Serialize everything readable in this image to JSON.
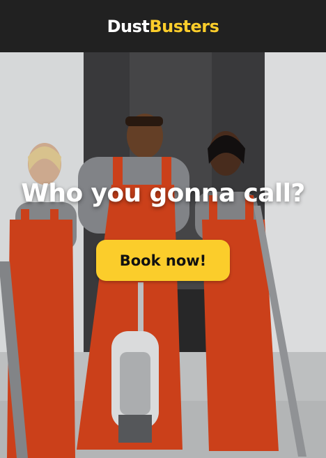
{
  "header": {
    "logo_part1": "Dust",
    "logo_part2": "Busters"
  },
  "hero": {
    "headline": "Who you gonna call?",
    "cta_label": "Book now!",
    "image_description": "Three cleaners in orange overalls with vacuum cleaners"
  },
  "colors": {
    "header_bg": "#212121",
    "accent": "#fbcd2b",
    "headline": "#ffffff",
    "overalls": "#d8441c"
  }
}
